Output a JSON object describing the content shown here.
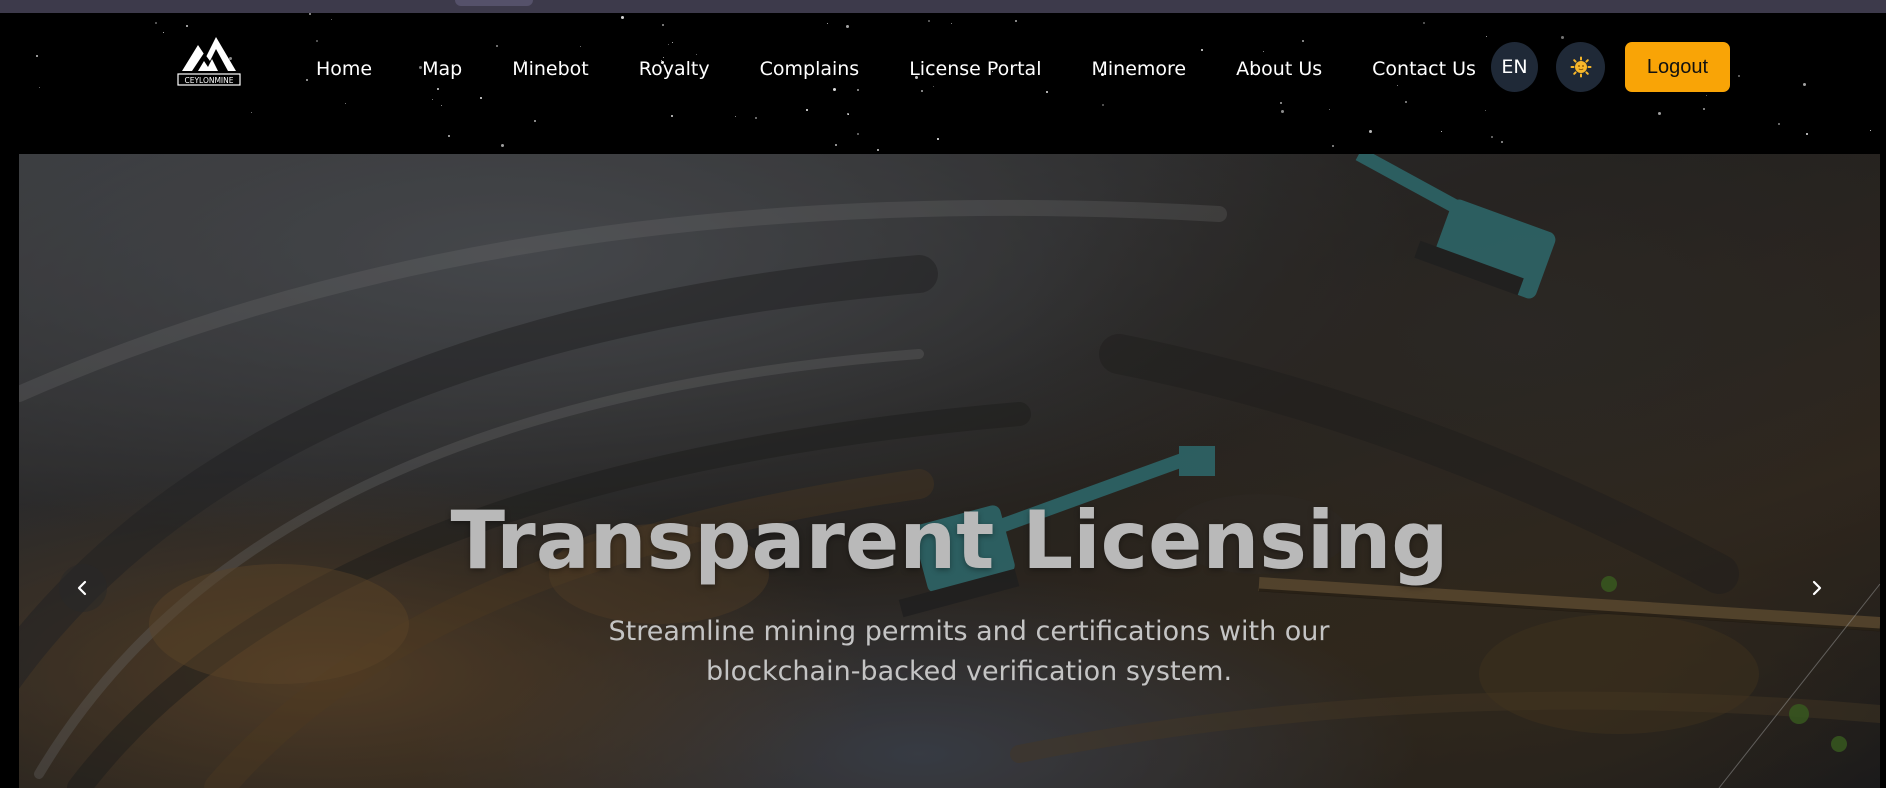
{
  "logo": {
    "text": "CEYLONMINE",
    "icon": "mountain-logo-icon"
  },
  "nav": {
    "links": [
      "Home",
      "Map",
      "Minebot",
      "Royalty",
      "Complains",
      "License Portal",
      "Minemore",
      "About Us",
      "Contact Us"
    ]
  },
  "controls": {
    "language": "EN",
    "theme_icon": "sun-icon",
    "logout_label": "Logout"
  },
  "hero": {
    "title": "Transparent Licensing",
    "subtitle": "Streamline mining permits and certifications with our blockchain-backed verification system.",
    "prev_icon": "chevron-left-icon",
    "next_icon": "chevron-right-icon"
  },
  "colors": {
    "accent": "#f9a406",
    "navbar_bg": "#000000",
    "control_bg": "#1f2937"
  }
}
